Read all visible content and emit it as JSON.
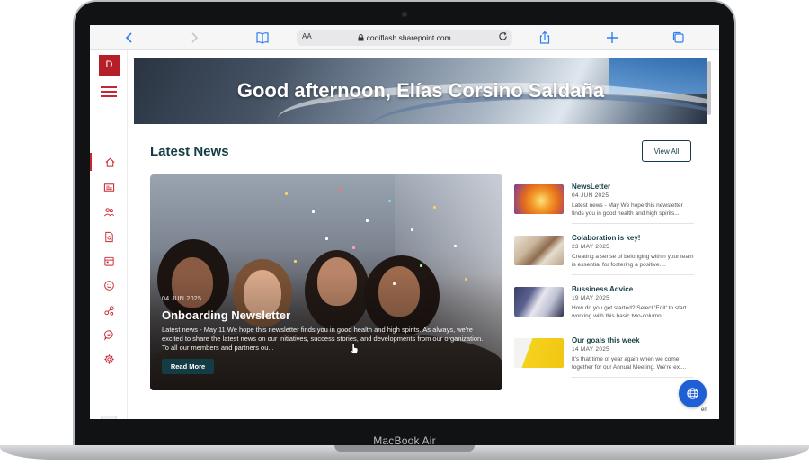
{
  "device": {
    "label": "MacBook Air"
  },
  "browser": {
    "text_size": "AA",
    "url": "codiflash.sharepoint.com",
    "icons": [
      "back-icon",
      "forward-icon",
      "bookmarks-icon",
      "reload-icon",
      "share-icon",
      "new-tab-icon",
      "tabs-icon"
    ]
  },
  "sidebar": {
    "avatar_initial": "D",
    "accent": "#c9252e",
    "items": [
      {
        "icon": "home-icon"
      },
      {
        "icon": "news-icon"
      },
      {
        "icon": "people-icon"
      },
      {
        "icon": "document-search-icon"
      },
      {
        "icon": "calendar-icon"
      },
      {
        "icon": "smile-icon"
      },
      {
        "icon": "share-links-icon"
      },
      {
        "icon": "chat-icon"
      },
      {
        "icon": "settings-icon"
      }
    ]
  },
  "hero": {
    "greeting": "Good afternoon, Elías Corsino Saldaña"
  },
  "news": {
    "section_title": "Latest News",
    "view_all_label": "View All",
    "featured": {
      "date": "04 JUN 2025",
      "title": "Onboarding Newsletter",
      "excerpt": "Latest news - May 11 We hope this newsletter finds you in good health and high spirits. As always, we're excited to share the latest news on our initiatives, success stories, and developments from our organization. To all our members and partners ou...",
      "button_label": "Read More"
    },
    "items": [
      {
        "title": "NewsLetter",
        "date": "04 JUN 2025",
        "excerpt": "Latest news - May We hope this newsletter finds you in good health and high spirits...."
      },
      {
        "title": "Colaboration is key!",
        "date": "23 MAY 2025",
        "excerpt": "Creating a sense of belonging within your team is essential for fostering a positive...."
      },
      {
        "title": "Bussiness Advice",
        "date": "19 MAY 2025",
        "excerpt": "How do you get started? Select 'Edit' to start working with this basic two-column...."
      },
      {
        "title": "Our goals this week",
        "date": "14 MAY 2025",
        "excerpt": "It's that time of year again when we come together for our Annual Meeting. We're ex...."
      }
    ]
  },
  "language": {
    "code": "en"
  },
  "colors": {
    "brand_dark": "#143c44",
    "brand_red": "#b51f28",
    "action_blue": "#1f5fd6"
  }
}
